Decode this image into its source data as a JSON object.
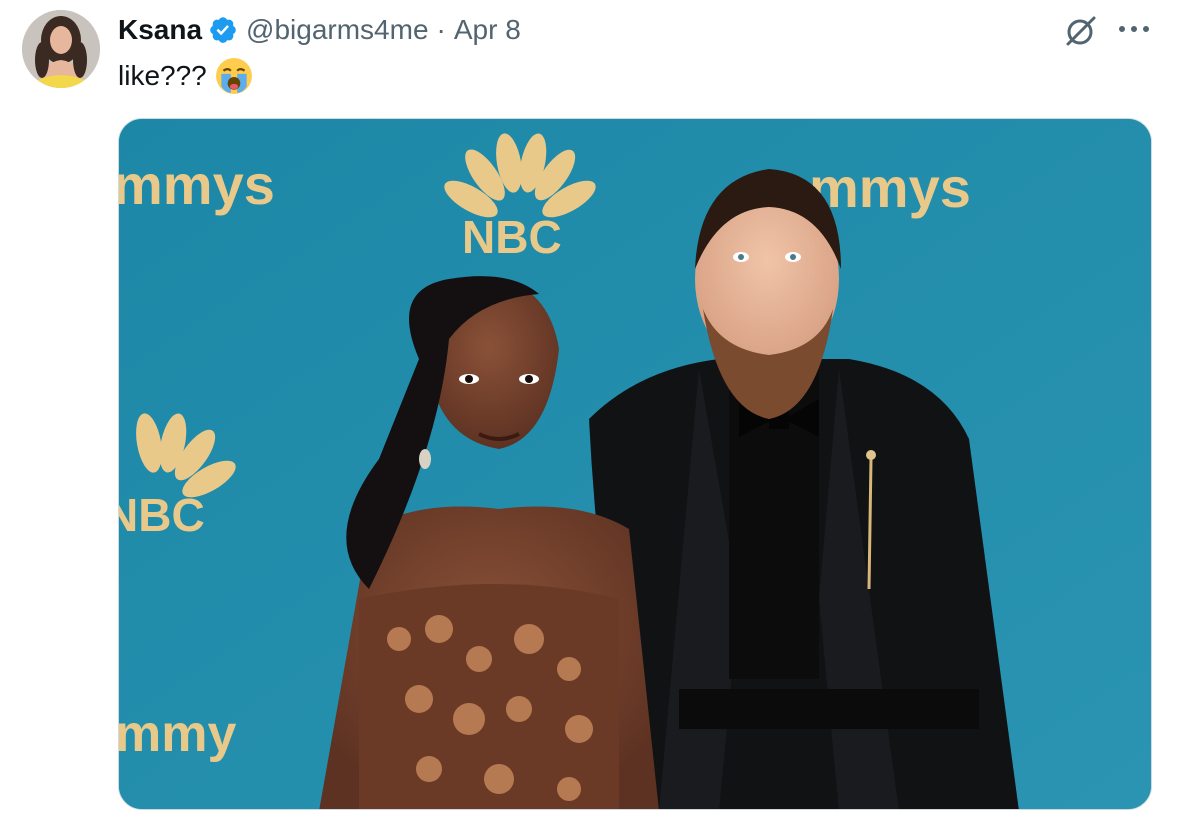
{
  "tweet": {
    "author": {
      "display_name": "Ksana",
      "handle": "@bigarms4me",
      "verified": true,
      "avatar_icon": "profile-photo"
    },
    "separator": "·",
    "timestamp": "Apr 8",
    "text": "like???",
    "emoji": "loudly-crying-face",
    "icons": {
      "grok": "grok-icon",
      "more": "more-icon"
    },
    "media": {
      "backdrop": {
        "brand_text": "NBC",
        "award_text": "mmys",
        "award_text_lower": "mmy"
      }
    }
  },
  "colors": {
    "text": "#0f1419",
    "muted": "#536471",
    "verified_blue": "#1d9bf0",
    "backdrop_teal": "#1e8aa9",
    "logo_gold": "#e9c98a"
  }
}
